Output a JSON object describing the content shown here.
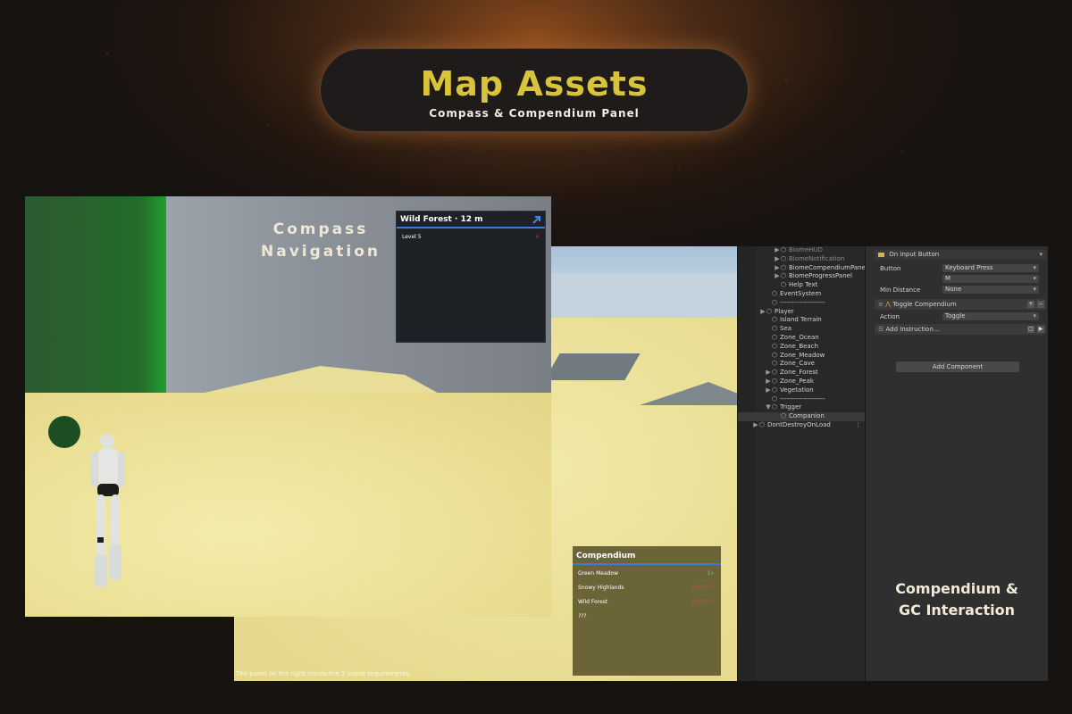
{
  "header": {
    "title": "Map Assets",
    "subtitle": "Compass & Compendium Panel"
  },
  "game_front": {
    "overlay_title_line1": "Compass",
    "overlay_title_line2": "Navigation",
    "compass": {
      "header": "Wild Forest · 12 m",
      "row_label": "Level 5",
      "row_mark": "×"
    }
  },
  "game_back": {
    "hint_text": "The panel on the right traces the 3 scene requirements.",
    "compendium": {
      "title": "Compendium",
      "rows": [
        {
          "name": "Green Meadow",
          "status": "1»"
        },
        {
          "name": "Snowy Highlands",
          "status": "LOCKED"
        },
        {
          "name": "Wild Forest",
          "status": "LOCKED"
        },
        {
          "name": "???",
          "status": ""
        }
      ]
    }
  },
  "hierarchy": {
    "items": [
      {
        "label": "BiomeHUD",
        "arrow": "▶",
        "muted": true
      },
      {
        "label": "BiomeNotification",
        "arrow": "▶",
        "muted": true
      },
      {
        "label": "BiomeCompendiumPanel",
        "arrow": "▶",
        "muted": false
      },
      {
        "label": "BiomeProgressPanel",
        "arrow": "▶",
        "muted": false
      },
      {
        "label": "Help Text",
        "arrow": "",
        "muted": false
      },
      {
        "label": "EventSystem",
        "arrow": "",
        "muted": false
      },
      {
        "label": "--------------------",
        "arrow": "",
        "muted": false
      },
      {
        "label": "Player",
        "arrow": "▶",
        "muted": false
      },
      {
        "label": "Island Terrain",
        "arrow": "",
        "muted": false
      },
      {
        "label": "Sea",
        "arrow": "",
        "muted": false
      },
      {
        "label": "Zone_Ocean",
        "arrow": "",
        "muted": false
      },
      {
        "label": "Zone_Beach",
        "arrow": "",
        "muted": false
      },
      {
        "label": "Zone_Meadow",
        "arrow": "",
        "muted": false
      },
      {
        "label": "Zone_Cave",
        "arrow": "",
        "muted": false
      },
      {
        "label": "Zone_Forest",
        "arrow": "▶",
        "muted": false
      },
      {
        "label": "Zone_Peak",
        "arrow": "▶",
        "muted": false
      },
      {
        "label": "Vegetation",
        "arrow": "▶",
        "muted": false
      },
      {
        "label": "--------------------",
        "arrow": "",
        "muted": false
      },
      {
        "label": "Trigger",
        "arrow": "▼",
        "muted": false
      },
      {
        "label": "Companion",
        "arrow": "",
        "muted": false,
        "selected": true
      },
      {
        "label": "DontDestroyOnLoad",
        "arrow": "▶",
        "muted": false,
        "dots": "⋮"
      }
    ]
  },
  "inspector": {
    "trigger_header": "On Input Button",
    "button_label": "Button",
    "button_value": "Keyboard Press",
    "key_value": "M",
    "min_distance_label": "Min Distance",
    "min_distance_value": "None",
    "instruction_header": "Toggle Compendium",
    "action_label": "Action",
    "action_value": "Toggle",
    "add_instruction": "Add Instruction...",
    "add_component": "Add Component",
    "caption_line1": "Compendium &",
    "caption_line2": "GC Interaction"
  },
  "colors": {
    "title_gold": "#d9c33a",
    "accent_blue": "#3d7bd4",
    "locked_red": "#d44444",
    "unlocked_green": "#5dd35d"
  }
}
